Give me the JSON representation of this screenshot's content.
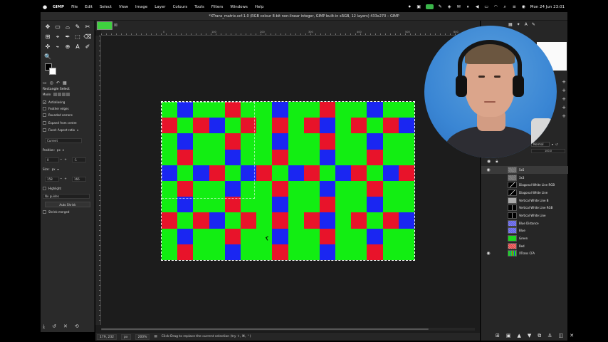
{
  "menubar": {
    "apple": "",
    "app_name": "GIMP",
    "items": [
      "File",
      "Edit",
      "Select",
      "View",
      "Image",
      "Layer",
      "Colours",
      "Tools",
      "Filters",
      "Windows",
      "Help"
    ],
    "clock": "Mon 24 Jun  23:01"
  },
  "window": {
    "title": "*XTrans_matrix.xcf-1.0 (RGB colour 8-bit non-linear integer, GIMP built-in sRGB, 12 layers) 433x270 – GIMP"
  },
  "toolbox": {
    "tools": [
      "✥",
      "▭",
      "⌓",
      "✎",
      "✂",
      "⊞",
      "⌖",
      "✒",
      "⬚",
      "⌫",
      "✜",
      "⌁",
      "⊕",
      "A",
      "✐",
      "🔍"
    ],
    "options_title": "Rectangle Select",
    "mode_label": "Mode:",
    "antialiasing": "Antialiasing",
    "feather_edges": "Feather edges",
    "rounded_corners": "Rounded corners",
    "expand_from_centre": "Expand from centre",
    "fixed_label": "Fixed: Aspect ratio",
    "current_value": "Current",
    "position_label": "Position:",
    "position_unit": "px",
    "position_x": "0",
    "position_y": "-1",
    "size_label": "Size:",
    "size_unit": "px",
    "size_w": "158",
    "size_h": "166",
    "highlight": "Highlight",
    "guides": "No guides",
    "auto_shrink": "Auto Shrink",
    "shrink_merged": "Shrink merged"
  },
  "canvas": {
    "ruler_labels": [
      "0",
      "100",
      "200",
      "300",
      "400",
      "500",
      "600",
      "700",
      "800",
      "900"
    ],
    "cfa_rows": [
      "GBGGRGGBGGRGGBGG",
      "RGRBGRGRGRBGRGRB",
      "GBGGRGGBGGRGGBGG",
      "GRGGBGGRGGBGGRGG",
      "BGBRGBRGBRGBRGBR",
      "GRGGBGGRGGBGGRGG",
      "GBGGRGGBGGRGGBGG",
      "RGRBGRGRGRBGRGRB",
      "GBGGRGGBGGRGGBGG",
      "GRGGBGGRGGBGGRGG"
    ],
    "colors": {
      "G": "#12ee12",
      "R": "#e8132a",
      "B": "#1a26f2"
    }
  },
  "statusbar": {
    "coords": "179, 232",
    "unit": "px",
    "zoom": "200%",
    "message": "Click-Drag to replace the current selection (try ⇧, ⌘, ⌃)"
  },
  "dock": {
    "mode": "Normal",
    "opacity": "100.0",
    "layers": [
      {
        "name": "5x5",
        "thumb": "th-check",
        "visible": true,
        "selected": true
      },
      {
        "name": "3x3",
        "thumb": "th-check",
        "visible": false
      },
      {
        "name": "Diagonal White Line RGB",
        "thumb": "th-diag",
        "visible": false
      },
      {
        "name": "Diagonal White Line",
        "thumb": "th-diag",
        "visible": false
      },
      {
        "name": "Vertical White Line B",
        "thumb": "th-gray",
        "visible": false
      },
      {
        "name": "Vertical White Line RGB",
        "thumb": "th-vline",
        "visible": false
      },
      {
        "name": "Vertical White Line",
        "thumb": "th-vline",
        "visible": false
      },
      {
        "name": "Blue Distance",
        "thumb": "th-blue",
        "visible": false
      },
      {
        "name": "Blue",
        "thumb": "th-blue",
        "visible": false
      },
      {
        "name": "Green",
        "thumb": "th-green",
        "visible": false
      },
      {
        "name": "Red",
        "thumb": "th-red",
        "visible": false
      },
      {
        "name": "XTrans CFA",
        "thumb": "th-xtrans",
        "visible": true
      }
    ]
  }
}
